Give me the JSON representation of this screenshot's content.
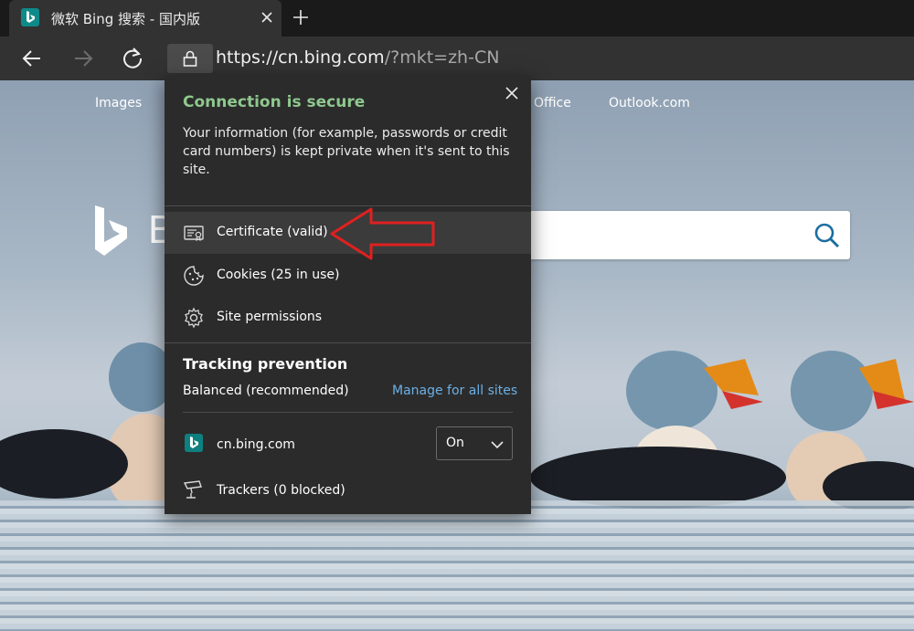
{
  "tab": {
    "title": "微软 Bing 搜索 - 国内版",
    "favicon": "bing-icon",
    "close_icon": "close-icon"
  },
  "toolbar": {
    "new_tab_icon": "plus-icon",
    "back_icon": "arrow-left-icon",
    "forward_icon": "arrow-right-icon",
    "refresh_icon": "refresh-icon",
    "lock_icon": "lock-icon",
    "url_host": "https://cn.bing.com",
    "url_path": "/?mkt=zh-CN"
  },
  "bing_page": {
    "nav": {
      "images": "Images",
      "office": "Office",
      "outlook": "Outlook.com"
    },
    "logo_text": "B"
  },
  "popup": {
    "title": "Connection is secure",
    "description": "Your information (for example, passwords or credit card numbers) is kept private when it's sent to this site.",
    "items": [
      {
        "label": "Certificate (valid)",
        "icon": "certificate-icon"
      },
      {
        "label": "Cookies (25 in use)",
        "icon": "cookie-icon"
      },
      {
        "label": "Site permissions",
        "icon": "gear-icon"
      }
    ],
    "tracking": {
      "title": "Tracking prevention",
      "mode": "Balanced (recommended)",
      "manage_link": "Manage for all sites",
      "site": "cn.bing.com",
      "toggle_value": "On",
      "trackers": "Trackers (0 blocked)"
    }
  },
  "colors": {
    "secure_green": "#8ec88e",
    "link_blue": "#6cb0e6",
    "annotation_red": "#e02020",
    "bing_teal": "#0f8080"
  }
}
